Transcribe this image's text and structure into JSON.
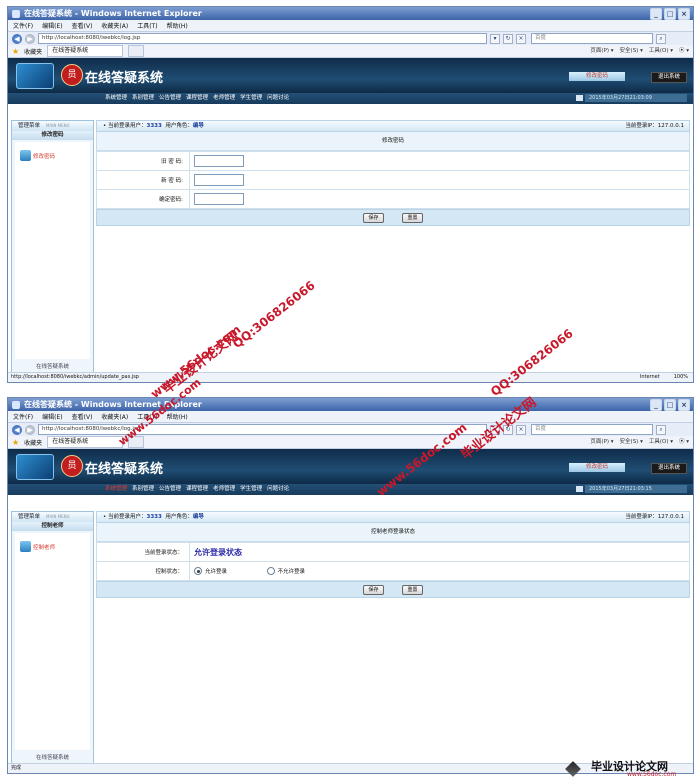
{
  "browser": {
    "title": "在线答疑系统 - Windows Internet Explorer",
    "title_short": "在线答疑系统 - Windows Internet Explorer",
    "menus": [
      "文件(F)",
      "编辑(E)",
      "查看(V)",
      "收藏夹(A)",
      "工具(T)",
      "帮助(H)"
    ],
    "address": "http://localhost:8080/iwebkc/log.jsp",
    "address2": "http://localhost:8080/iwebkc/log.jsp",
    "search_placeholder": "百度",
    "favorites": "收藏夹",
    "tab_label": "在线答疑系统",
    "commands": [
      "页面(P) ▾",
      "安全(S) ▾",
      "工具(O) ▾",
      "⦿ ▾"
    ],
    "zone": "Internet",
    "zoom": "100%"
  },
  "app": {
    "title": "在线答疑系统",
    "seal_char": "员",
    "header_button1": "修改密码",
    "header_button2": "退出系统",
    "nav": [
      "系统管理",
      "系别管理",
      "公告管理",
      "课程管理",
      "老师管理",
      "学生管理",
      "问题讨论"
    ],
    "nav_time1": "2015年03月27日21:03:09",
    "nav_time2": "2015年03月27日21:03:15",
    "sidebar_title": "管理菜单",
    "sidebar_title_en": "MAIN MENU",
    "sidebar_footer": "在线答疑系统",
    "info_user_label": "当前登录用户：",
    "info_user": "3333",
    "info_role_label": "用户角色：",
    "info_role": "编导",
    "info_ip": "当前登录IP：127.0.0.1"
  },
  "screen1": {
    "sidebar_sub": "修改密码",
    "sidebar_item": "修改密码",
    "form_title": "修改密码",
    "fields": [
      "旧 密 码:",
      "新 密 码:",
      "确定密码:"
    ],
    "save": "保存",
    "reset": "重置",
    "status_url": "http://localhost:8080/iwebkc/admin/update_pas.jsp"
  },
  "screen2": {
    "sidebar_sub": "控制老师",
    "sidebar_item": "控制老师",
    "form_title": "控制老师登录状态",
    "row1_label": "当前登录状态：",
    "row1_value": "允许登录状态",
    "row2_label": "控制状态：",
    "radio_on": "允许登录",
    "radio_off": "不允许登录",
    "save": "保存",
    "reset": "重置",
    "status_text": "完成"
  },
  "watermarks": {
    "site_cn": "毕业设计论文网",
    "site_url": "www.56doc.com",
    "qq": "QQ:306826066"
  },
  "brand": {
    "name": "毕业设计论文网",
    "url": "www.56doc.com"
  }
}
